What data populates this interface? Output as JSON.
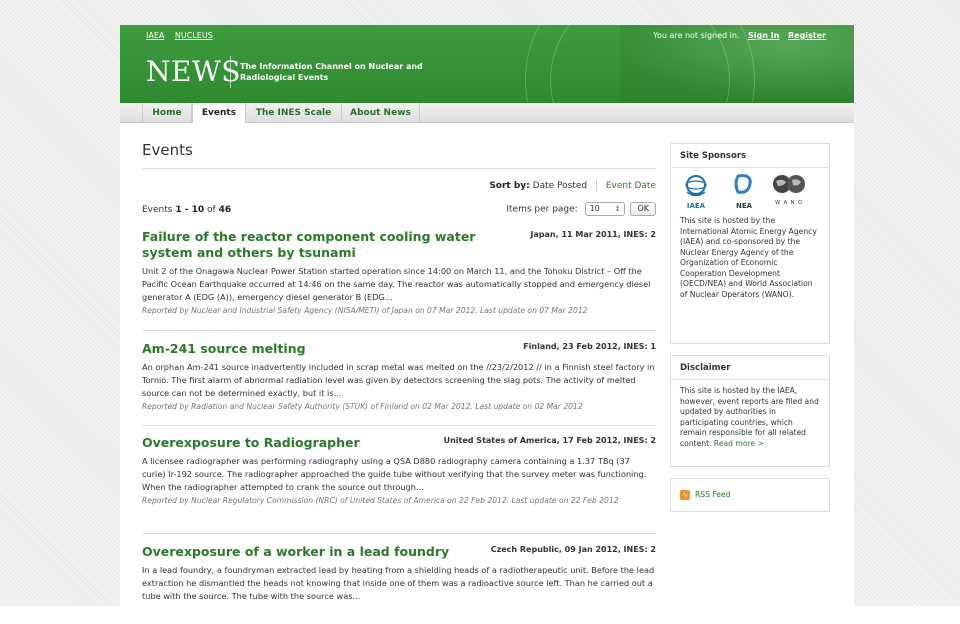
{
  "header": {
    "top_links": [
      "IAEA",
      "NUCLEUS"
    ],
    "signin_text": "You are not signed in.",
    "signin_label": "Sign In",
    "register_label": "Register",
    "logo": "NEWS",
    "tagline": "The Information Channel on Nuclear and Radiological Events",
    "color": "#3e9b3e"
  },
  "nav": {
    "items": [
      "Home",
      "Events",
      "The INES Scale",
      "About News"
    ],
    "active": "Events"
  },
  "main": {
    "title": "Events",
    "sort_label": "Sort by:",
    "sort_options": [
      "Date Posted",
      "Event Date"
    ],
    "count_prefix": "Events",
    "count_range": "1 - 10",
    "count_of": "of",
    "count_total": "46",
    "per_page_label": "Items per page:",
    "per_page_value": "10",
    "ok_label": "OK"
  },
  "events": [
    {
      "title": "Failure of the reactor component cooling water system and others by tsunami",
      "meta": "Japan, 11 Mar 2011, INES: 2",
      "summary": "Unit 2 of the Onagawa Nuclear Power Station started operation since 14:00 on March 11, and the Tohoku District – Off the Pacific Ocean Earthquake occurred at 14:46 on the same day. The reactor was automatically stopped and emergency diesel generator A (EDG (A)), emergency diesel generator B (EDG...",
      "report": "Reported by Nuclear and Industrial Safety Agency (NISA/METI) of Japan on 07 Mar 2012. Last update on 07 Mar 2012"
    },
    {
      "title": "Am-241 source melting",
      "meta": "Finland, 23 Feb 2012, INES: 1",
      "summary": "An orphan Am-241 source inadvertently included in scrap metal was melted on the //23/2/2012 // in a Finnish steel factory in Tornio. The first alarm of abnormal radiation level was given by detectors screening the slag pots. The activity of melted source can not be determined exactly, but it is...",
      "report": "Reported by Radiation and Nuclear Safety Authority (STUK) of Finland on 02 Mar 2012. Last update on 02 Mar 2012"
    },
    {
      "title": "Overexposure to Radiographer",
      "meta": "United States of America, 17 Feb 2012, INES: 2",
      "summary": "A licensee radiographer was performing radiography using a QSA D880 radiography camera containing a 1.37 TBq (37 curie) Ir-192 source. The radiographer approached the guide tube without verifying that the survey meter was functioning. When the radiographer attempted to crank the source out through...",
      "report": "Reported by Nuclear Regulatory Commission (NRC) of United States of America on 22 Feb 2012. Last update on 22 Feb 2012"
    },
    {
      "title": "Overexposure of a worker in a lead foundry",
      "meta": "Czech Republic, 09 Jan 2012, INES: 2",
      "summary": "In a lead foundry, a foundryman extracted lead by heating from a shielding heads of a radiotherapeutic unit. Before the lead extraction he dismantled the heads not knowing that inside one of them was a radioactive source left. Than he carried out a tube with the source. The tube with the source was...",
      "report": ""
    }
  ],
  "sidebar": {
    "sponsors_title": "Site Sponsors",
    "sponsor_logos": [
      "IAEA",
      "NEA",
      "W A N O"
    ],
    "sponsors_text": "This site is hosted by the International Atomic Energy Agency (IAEA) and co-sponsored by the Nuclear Energy Agency of the Organization of Economic Cooperation Development (OECD/NEA) and World Association of Nuclear Operators (WANO).",
    "disclaimer_title": "Disclaimer",
    "disclaimer_text": "This site is hosted by the IAEA, however, event reports are filed and updated by authorities in participating countries, which remain responsible for all related content.",
    "read_more": "Read more >",
    "rss_label": "RSS Feed"
  }
}
